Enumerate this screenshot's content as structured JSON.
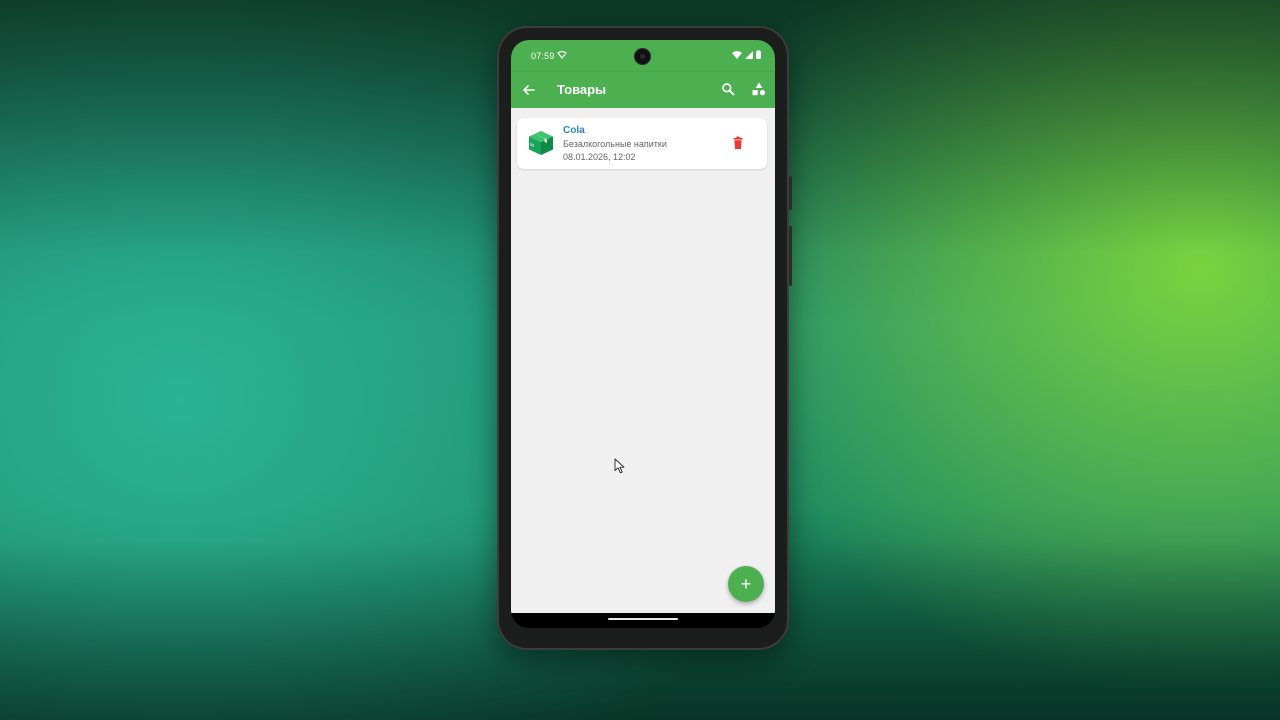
{
  "status_bar": {
    "time": "07:59",
    "left_icon": "signal-outline-icon",
    "right_icons": [
      "wifi-icon",
      "cell-signal-icon",
      "battery-icon"
    ]
  },
  "app_bar": {
    "title": "Товары",
    "back_icon": "arrow-left-icon",
    "actions": [
      "search-icon",
      "shapes-icon"
    ]
  },
  "products": [
    {
      "name": "Cola",
      "category": "Безалкогольные напитки",
      "date": "08.01.2026, 12:02",
      "icon": "package-box-icon",
      "action_icon": "trash-icon"
    }
  ],
  "fab": {
    "label": "+",
    "icon": "plus-icon"
  },
  "colors": {
    "primary": "#4caf50",
    "title_text": "#2a86c7",
    "delete": "#e53935",
    "box_icon": "#1aa35a",
    "content_bg": "#f0f0f0"
  }
}
